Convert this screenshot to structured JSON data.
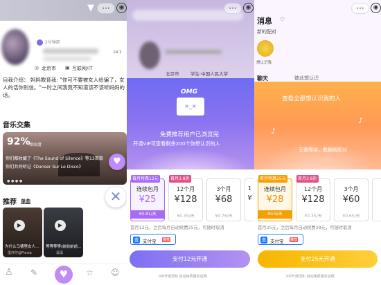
{
  "left": {
    "post_time": "2分钟前",
    "level": "LV.1",
    "location": "北京市",
    "industry": "互联网/IT",
    "bio": "自我介绍：  妈妈教育我: \"你可不要被女人给骗了，女人的话你别信。\"一时之间我竟不知道该不该听妈妈的话。",
    "music_title": "音乐交集",
    "music_percent": "92%",
    "music_percent_label": "相似度",
    "music_line1": "你们都收藏了《The Sound of Silence》等13首歌",
    "music_line2": "你们共同听过《Danser Sur Le Disco》",
    "recommend_title": "推荐",
    "recommend_tab": "单曲",
    "song1_title": "为什么马德里女人...",
    "song1_artist": "蛋仔仔@Flavia",
    "song2_title": "等等等等(前前前前...",
    "song2_artist": "凛凛",
    "colors": {
      "accent": "#8b5cf6",
      "like": "#c08af7"
    }
  },
  "mid": {
    "location": "北京市",
    "school": "学生·中国人民大学",
    "brand": "OMG",
    "headline": "免费推荐用户已浏览完",
    "subline": "开通VIP可查看剩余200个你想认识的人",
    "plans": [
      {
        "tag": "首月特惠12元",
        "name": "连续包月",
        "price": "¥25",
        "per": "¥0.81/天"
      },
      {
        "tag": "首月3.8折",
        "name": "12个月",
        "price": "¥128",
        "per": "¥0.35/天"
      },
      {
        "tag": "",
        "name": "3个月",
        "price": "¥68",
        "per": "¥0.76/天"
      },
      {
        "tag": "",
        "name": "1",
        "price": "¥",
        "per": ""
      }
    ],
    "note": "首月12元，之后每月自动续费25元，可随时取消",
    "pay_method": "支付宝",
    "pay_badge": "推荐",
    "cta": "支付12元开通",
    "footer": "VIP开通须知  自动续费服务说明"
  },
  "right": {
    "title": "消息",
    "subtitle": "新的配对",
    "avatar_label": "想认识我",
    "tab_chat": "聊天",
    "tab_suggest": "彼此想认识",
    "headline": "查看全部想认识我的人",
    "subline": "无需等待，数据就配对",
    "plans": [
      {
        "tag": "首月特惠25元",
        "name": "连续包月",
        "price": "¥28",
        "per": "¥0.9/天"
      },
      {
        "tag": "首月3.8折",
        "name": "12个月",
        "price": "¥128",
        "per": "¥0.35/天"
      },
      {
        "tag": "",
        "name": "3个月",
        "price": "¥60",
        "per": "¥0.65/天"
      }
    ],
    "note": "首月25元，之后每月自动续费28元，可随时取消",
    "pay_method": "支付宝",
    "pay_badge": "推荐",
    "cta": "支付25元开通",
    "footer": "VIP开通须知  自动续费服务说明"
  }
}
